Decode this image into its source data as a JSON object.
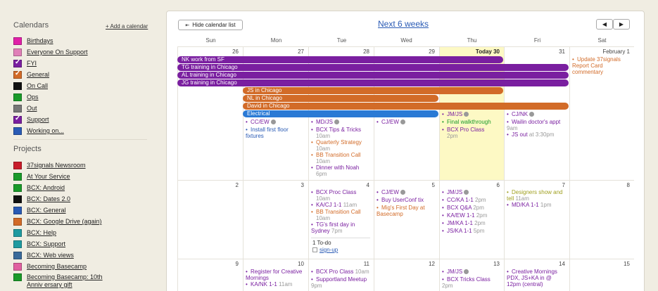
{
  "sidebar": {
    "calendars_title": "Calendars",
    "add_calendar": "+ Add a calendar",
    "calendars": [
      {
        "label": "Birthdays",
        "color": "#e020a8",
        "checked": false
      },
      {
        "label": "Everyone On Support",
        "color": "#e080b8",
        "checked": false
      },
      {
        "label": "FYI",
        "color": "#7a1fa0",
        "checked": true
      },
      {
        "label": "General",
        "color": "#d26b28",
        "checked": true
      },
      {
        "label": "On Call",
        "color": "#111111",
        "checked": false
      },
      {
        "label": "Ops",
        "color": "#1a9a2a",
        "checked": false
      },
      {
        "label": "Out",
        "color": "#777777",
        "checked": false
      },
      {
        "label": "Support",
        "color": "#7a1fa0",
        "checked": true
      },
      {
        "label": "Working on...",
        "color": "#2a5bb5",
        "checked": false
      }
    ],
    "projects_title": "Projects",
    "projects": [
      {
        "label": "37signals Newsroom",
        "color": "#c81c2a"
      },
      {
        "label": "At Your Service",
        "color": "#1a9a2a"
      },
      {
        "label": "BCX: Android",
        "color": "#1a9a2a"
      },
      {
        "label": "BCX: Dates 2.0",
        "color": "#111111"
      },
      {
        "label": "BCX: General",
        "color": "#2a5bb5"
      },
      {
        "label": "BCX: Google Drive (again)",
        "color": "#d26b28"
      },
      {
        "label": "BCX: Help",
        "color": "#1f9aa0"
      },
      {
        "label": "BCX: Support",
        "color": "#1f9aa0"
      },
      {
        "label": "BCX: Web views",
        "color": "#3a6a9a"
      },
      {
        "label": "Becoming Basecamp",
        "color": "#e060a0"
      },
      {
        "label": "Becoming Basecamp: 10th Anniv ersary gift",
        "color": "#1a9a2a"
      }
    ]
  },
  "header": {
    "hide_list": "Hide calendar list",
    "title": "Next 6 weeks",
    "prev": "◀",
    "next": "▶"
  },
  "days_of_week": [
    "Sun",
    "Mon",
    "Tue",
    "Wed",
    "Thu",
    "Fri",
    "Sat"
  ],
  "weeks": [
    {
      "days": [
        "26",
        "27",
        "28",
        "29",
        "Today 30",
        "31",
        "February 1"
      ]
    },
    {
      "days": [
        "2",
        "3",
        "4",
        "5",
        "6",
        "7",
        "8"
      ]
    },
    {
      "days": [
        "9",
        "10",
        "11",
        "12",
        "13",
        "14",
        "15"
      ]
    }
  ],
  "bars": [
    {
      "label": "NK work from SF",
      "color": "#7a1fa0"
    },
    {
      "label": "TG training in Chicago",
      "color": "#7a1fa0"
    },
    {
      "label": "AL training in Chicago",
      "color": "#7a1fa0"
    },
    {
      "label": "JG training in Chicago",
      "color": "#7a1fa0"
    },
    {
      "label": "JS in Chicago",
      "color": "#d26b28"
    },
    {
      "label": "NL in Chicago",
      "color": "#d26b28"
    },
    {
      "label": "David in Chicago",
      "color": "#d26b28"
    },
    {
      "label": "Electrical",
      "color": "#2a7ad5"
    }
  ],
  "events": [
    {
      "text": "CC/EW",
      "time": "",
      "color": "#7a1fa0",
      "clock": true
    },
    {
      "text": "Install first floor fixtures",
      "time": "",
      "color": "#2a5bb5",
      "clock": false
    },
    {
      "text": "MD/JS",
      "time": "",
      "color": "#7a1fa0",
      "clock": true
    },
    {
      "text": "BCX Tips & Tricks",
      "time": "10am",
      "color": "#7a1fa0",
      "clock": false
    },
    {
      "text": "Quarterly Strategy",
      "time": "10am",
      "color": "#d26b28",
      "clock": false
    },
    {
      "text": "BB Transition Call",
      "time": "10am",
      "color": "#d26b28",
      "clock": false
    },
    {
      "text": "Dinner with Noah",
      "time": "6pm",
      "color": "#7a1fa0",
      "clock": false
    },
    {
      "text": "CJ/EW",
      "time": "",
      "color": "#7a1fa0",
      "clock": true
    },
    {
      "text": "JM/JS",
      "time": "",
      "color": "#7a1fa0",
      "clock": true
    },
    {
      "text": "Final walkthrough",
      "time": "",
      "color": "#1a9a2a",
      "clock": false
    },
    {
      "text": "BCX Pro Class",
      "time": "2pm",
      "color": "#7a1fa0",
      "clock": false
    },
    {
      "text": "CJ/NK",
      "time": "",
      "color": "#7a1fa0",
      "clock": true
    },
    {
      "text": "Wailin doctor's appt",
      "time": "9am",
      "color": "#7a1fa0",
      "clock": false
    },
    {
      "text": "JS out",
      "time": "at 3:30pm",
      "color": "#7a1fa0",
      "clock": false
    },
    {
      "text": "Update 37signals Report Card commentary",
      "time": "",
      "color": "#d26b28",
      "clock": false
    },
    {
      "text": "BCX Proc Class",
      "time": "10am",
      "color": "#7a1fa0",
      "clock": false
    },
    {
      "text": "KA/CJ 1-1",
      "time": "11am",
      "color": "#7a1fa0",
      "clock": false
    },
    {
      "text": "BB Transition Call",
      "time": "10am",
      "color": "#d26b28",
      "clock": false
    },
    {
      "text": "TG's first day in Sydney",
      "time": "7pm",
      "color": "#7a1fa0",
      "clock": false
    },
    {
      "text": "CJ/EW",
      "time": "",
      "color": "#7a1fa0",
      "clock": true
    },
    {
      "text": "Buy UserConf tix",
      "time": "",
      "color": "#7a1fa0",
      "clock": false
    },
    {
      "text": "Mig's First Day at Basecamp",
      "time": "",
      "color": "#d26b28",
      "clock": false
    },
    {
      "text": "JM/JS",
      "time": "",
      "color": "#7a1fa0",
      "clock": true
    },
    {
      "text": "CC/KA 1-1",
      "time": "2pm",
      "color": "#7a1fa0",
      "clock": false
    },
    {
      "text": "BCX Q&A",
      "time": "2pm",
      "color": "#7a1fa0",
      "clock": false
    },
    {
      "text": "KA/EW 1-1",
      "time": "2pm",
      "color": "#7a1fa0",
      "clock": false
    },
    {
      "text": "JM/KA 1-1",
      "time": "2pm",
      "color": "#7a1fa0",
      "clock": false
    },
    {
      "text": "JS/KA 1-1",
      "time": "5pm",
      "color": "#7a1fa0",
      "clock": false
    },
    {
      "text": "Designers show and tell",
      "time": "11am",
      "color": "#a0a020",
      "clock": false
    },
    {
      "text": "MD/KA 1-1",
      "time": "1pm",
      "color": "#7a1fa0",
      "clock": false
    },
    {
      "text": "Register for Creative Mornings",
      "time": "",
      "color": "#7a1fa0",
      "clock": false
    },
    {
      "text": "KA/NK 1-1",
      "time": "11am",
      "color": "#7a1fa0",
      "clock": false
    },
    {
      "text": "BCX Pro Class",
      "time": "10am",
      "color": "#7a1fa0",
      "clock": false
    },
    {
      "text": "Supportland Meetup",
      "time": "9pm",
      "color": "#7a1fa0",
      "clock": false
    },
    {
      "text": "JM/JS",
      "time": "",
      "color": "#7a1fa0",
      "clock": true
    },
    {
      "text": "BCX Tricks Class",
      "time": "2pm",
      "color": "#7a1fa0",
      "clock": false
    },
    {
      "text": "Creative Mornings PDX, JS+KA in @ 12pm (central)",
      "time": "",
      "color": "#7a1fa0",
      "clock": false
    }
  ],
  "todo": {
    "title": "1 To-do",
    "item": "sign-up"
  }
}
